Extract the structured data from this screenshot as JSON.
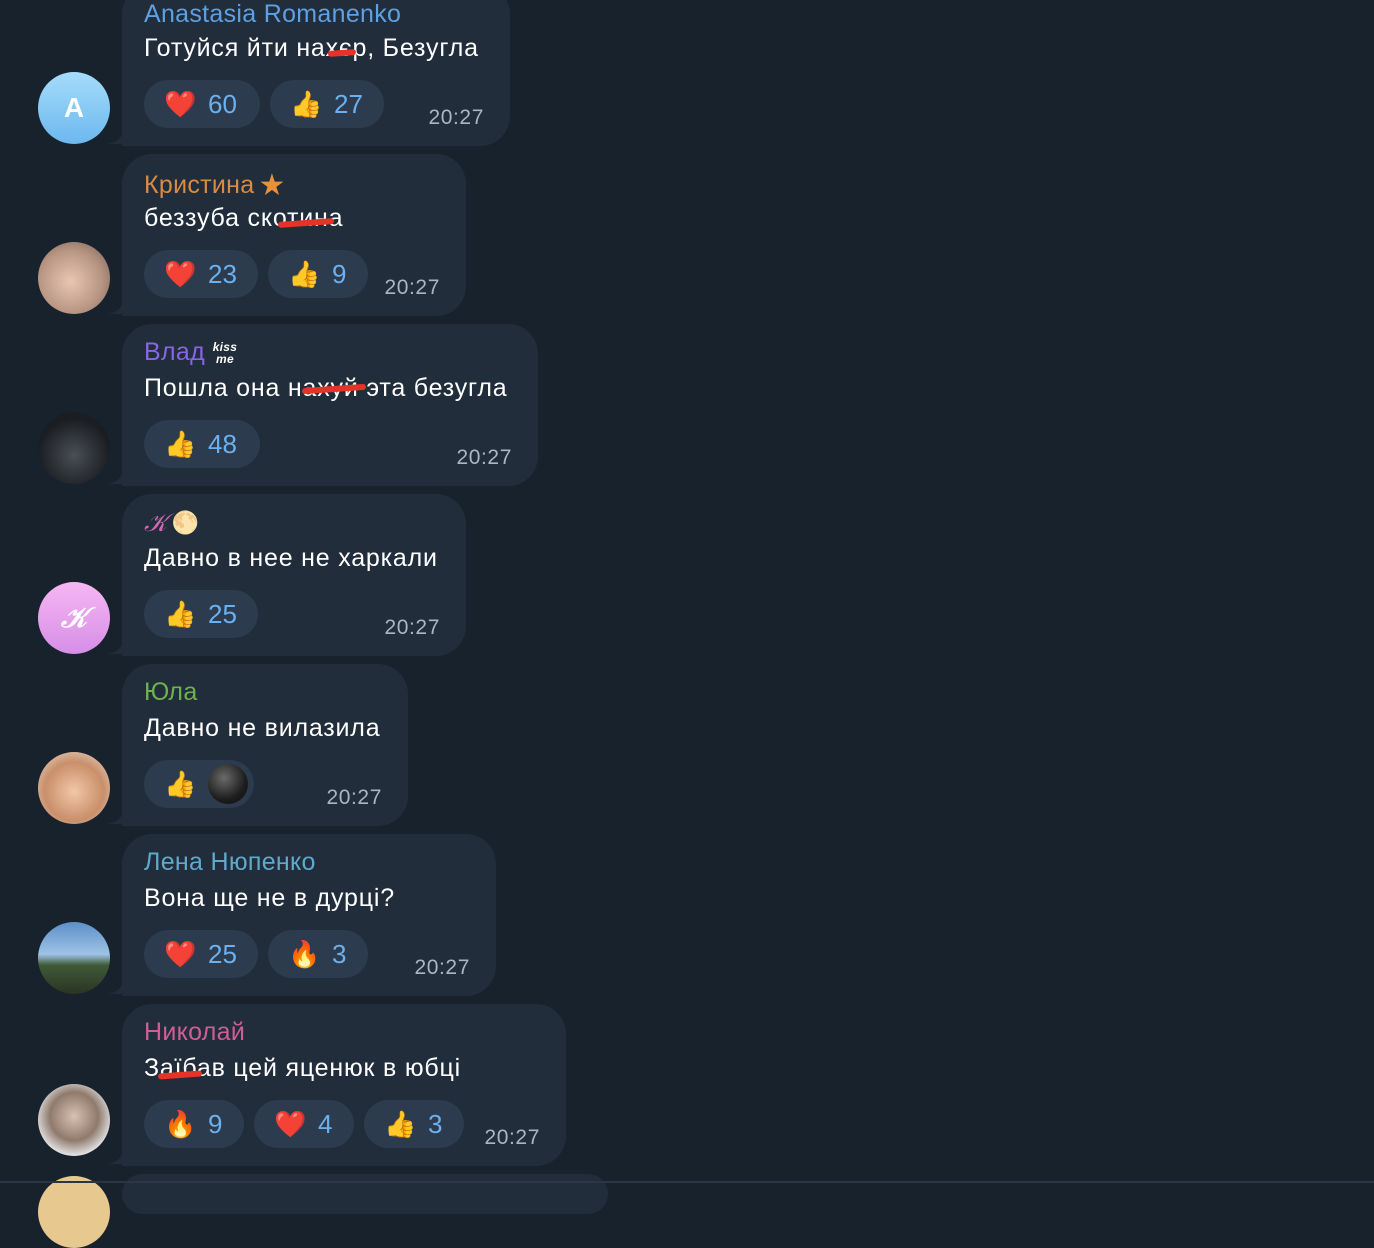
{
  "colors": {
    "background": "#18222d",
    "bubble": "#212d3b",
    "reaction_bg": "#2c3b4d",
    "count": "#6bb1f0",
    "time": "#a9b6c3"
  },
  "messages": [
    {
      "author": "Anastasia Romanenko",
      "author_color": "#5da0e4",
      "text": "Готуйся йти нахєр, Безугла",
      "avatar": {
        "type": "letter",
        "letter": "A",
        "bg": "linear-gradient(180deg,#a5dcfa,#6cb8ef)"
      },
      "reactions": [
        {
          "emoji": "❤️",
          "icon": "heart-icon",
          "count": "60"
        },
        {
          "emoji": "👍",
          "icon": "thumbs-up-icon",
          "count": "27"
        }
      ],
      "time": "20:27"
    },
    {
      "author": "Кристина",
      "author_color": "#d98a43",
      "badge": "★",
      "badge_icon": "star-icon",
      "text": "беззуба скотина",
      "avatar": {
        "type": "photo",
        "bg": "radial-gradient(circle at 45% 55%,#e8c6b2,#b99684 55%,#6e5a4f)"
      },
      "reactions": [
        {
          "emoji": "❤️",
          "icon": "heart-icon",
          "count": "23"
        },
        {
          "emoji": "👍",
          "icon": "thumbs-up-icon",
          "count": "9"
        }
      ],
      "time": "20:27"
    },
    {
      "author": "Влад",
      "author_color": "#8765e6",
      "badge": "kiss me",
      "badge_icon": "kiss-me-sticker-icon",
      "text": "Пошла она нахуй эта безугла",
      "avatar": {
        "type": "photo",
        "bg": "radial-gradient(circle at 50% 60%,#4a4f55,#1a1d21 65%)"
      },
      "reactions": [
        {
          "emoji": "👍",
          "icon": "thumbs-up-icon",
          "count": "48"
        }
      ],
      "time": "20:27"
    },
    {
      "author": "𝒦",
      "author_color": "#d367b3",
      "badge": "🌕",
      "badge_icon": "moon-icon",
      "text": "Давно в нее не харкали",
      "avatar": {
        "type": "letter",
        "letter": "𝒦",
        "bg": "linear-gradient(180deg,#f6b7f2,#d68ee7)"
      },
      "reactions": [
        {
          "emoji": "👍",
          "icon": "thumbs-up-icon",
          "count": "25"
        }
      ],
      "time": "20:27"
    },
    {
      "author": "Юла",
      "author_color": "#6cb34c",
      "text": "Давно не вилазила",
      "avatar": {
        "type": "photo",
        "bg": "radial-gradient(circle at 50% 55%,#f2c7a8,#c98f6a 55%,#e8e4dc)"
      },
      "reactions": [
        {
          "emoji": "👍",
          "icon": "thumbs-up-icon",
          "count": "",
          "extra": "reactor-avatar"
        }
      ],
      "time": "20:27"
    },
    {
      "author": "Лена Нюпенко",
      "author_color": "#5fa9cc",
      "text": "Вона ще не в дурці?",
      "avatar": {
        "type": "photo",
        "bg": "linear-gradient(180deg,#5d8fc9 0%,#9ec3e6 45%,#3f5a36 60%,#2a3424 100%)"
      },
      "reactions": [
        {
          "emoji": "❤️",
          "icon": "heart-icon",
          "count": "25"
        },
        {
          "emoji": "🔥",
          "icon": "fire-icon",
          "count": "3"
        }
      ],
      "time": "20:27"
    },
    {
      "author": "Николай",
      "author_color": "#cf5f92",
      "text": "Заїбав цей яценюк в юбці",
      "avatar": {
        "type": "photo",
        "bg": "radial-gradient(circle at 50% 45%,#d8c2b2,#8f7a6c 45%,#e9ebee 75%)"
      },
      "reactions": [
        {
          "emoji": "🔥",
          "icon": "fire-icon",
          "count": "9"
        },
        {
          "emoji": "❤️",
          "icon": "heart-icon",
          "count": "4"
        },
        {
          "emoji": "👍",
          "icon": "thumbs-up-icon",
          "count": "3"
        }
      ],
      "time": "20:27"
    }
  ]
}
